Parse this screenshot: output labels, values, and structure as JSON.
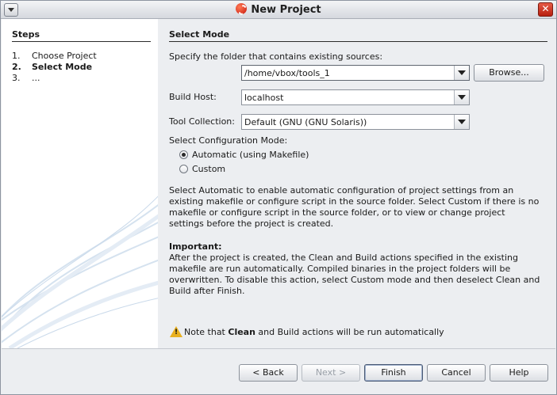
{
  "window": {
    "title": "New Project"
  },
  "steps": {
    "heading": "Steps",
    "items": [
      {
        "num": "1.",
        "label": "Choose Project"
      },
      {
        "num": "2.",
        "label": "Select Mode"
      },
      {
        "num": "3.",
        "label": "..."
      }
    ]
  },
  "panel": {
    "heading": "Select Mode",
    "folder_label": "Specify the folder that contains existing sources:",
    "folder_value": "/home/vbox/tools_1",
    "browse_label": "Browse...",
    "build_host_label": "Build Host:",
    "build_host_value": "localhost",
    "tool_collection_label": "Tool Collection:",
    "tool_collection_value": "Default (GNU (GNU Solaris))",
    "config_mode_label": "Select Configuration Mode:",
    "radio_automatic": "Automatic (using Makefile)",
    "radio_custom": "Custom",
    "description": "Select Automatic to enable automatic configuration of project settings from an existing makefile or configure script in the source folder. Select Custom if there is no makefile or configure script in the source folder, or to view or change project settings before the project is created.",
    "important_heading": "Important:",
    "important_text": "After the project is created, the Clean and Build actions specified in the existing makefile are run automatically. Compiled binaries in the project folders will be overwritten. To disable this action, select Custom mode and then deselect Clean and Build after Finish.",
    "note_prefix": "Note that ",
    "note_bold": "Clean",
    "note_suffix": " and Build actions will be run automatically"
  },
  "buttons": {
    "back": "< Back",
    "next": "Next >",
    "finish": "Finish",
    "cancel": "Cancel",
    "help": "Help"
  }
}
